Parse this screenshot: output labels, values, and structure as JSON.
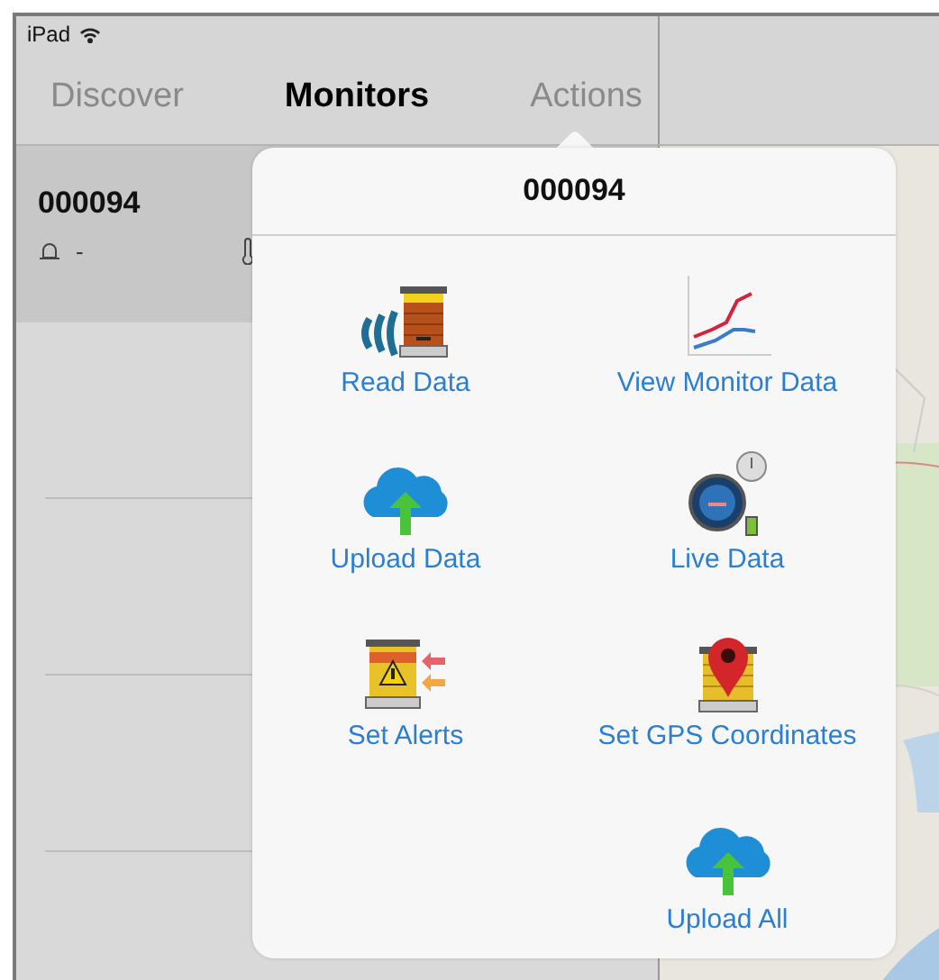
{
  "status_bar": {
    "device": "iPad"
  },
  "tabs": [
    {
      "label": "Discover",
      "selected": false
    },
    {
      "label": "Monitors",
      "selected": true
    },
    {
      "label": "Actions",
      "selected": false
    }
  ],
  "monitors": [
    {
      "name": "000094",
      "reading": "-",
      "selected": true
    }
  ],
  "popover": {
    "title": "000094",
    "rows": [
      {
        "left": {
          "label": "Read Data",
          "kind": "read"
        },
        "right": {
          "label": "View Monitor Data",
          "kind": "chart"
        }
      },
      {
        "left": {
          "label": "Upload Data",
          "kind": "upload"
        },
        "right": {
          "label": "Live Data",
          "kind": "live"
        }
      },
      {
        "left": {
          "label": "Set Alerts",
          "kind": "alerts"
        },
        "right": {
          "label": "Set GPS Coordinates",
          "kind": "gps"
        }
      },
      {
        "right": {
          "label": "Upload All",
          "kind": "upload"
        }
      }
    ]
  }
}
